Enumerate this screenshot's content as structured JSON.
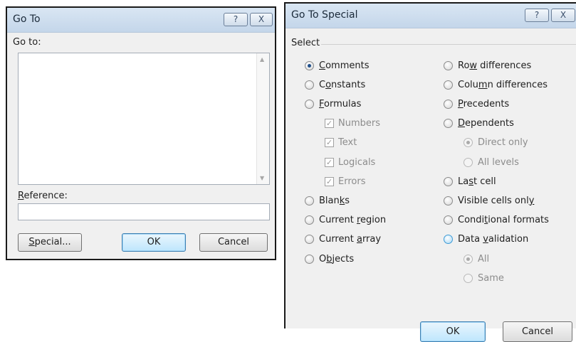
{
  "goto": {
    "title": "Go To",
    "help_btn": "?",
    "close_btn": "X",
    "goto_label": "Go to:",
    "reference_label_prefix": "",
    "reference_label_u": "R",
    "reference_label_rest": "eference:",
    "reference_value": "",
    "special_u": "S",
    "special_rest": "pecial...",
    "ok": "OK",
    "cancel": "Cancel",
    "scroll_up": "▲",
    "scroll_down": "▼"
  },
  "gotospecial": {
    "title": "Go To Special",
    "help_btn": "?",
    "close_btn": "X",
    "group_label": "Select",
    "left": [
      {
        "pre": "",
        "u": "C",
        "post": "omments",
        "kind": "radio",
        "checked": true
      },
      {
        "pre": "C",
        "u": "o",
        "post": "nstants",
        "kind": "radio",
        "checked": false
      },
      {
        "pre": "",
        "u": "F",
        "post": "ormulas",
        "kind": "radio",
        "checked": false
      },
      {
        "pre": "Numbers",
        "u": "",
        "post": "",
        "kind": "check",
        "checked": true,
        "disabled": true
      },
      {
        "pre": "Text",
        "u": "",
        "post": "",
        "kind": "check",
        "checked": true,
        "disabled": true
      },
      {
        "pre": "Logicals",
        "u": "",
        "post": "",
        "kind": "check",
        "checked": true,
        "disabled": true
      },
      {
        "pre": "Errors",
        "u": "",
        "post": "",
        "kind": "check",
        "checked": true,
        "disabled": true
      },
      {
        "pre": "Blan",
        "u": "k",
        "post": "s",
        "kind": "radio",
        "checked": false
      },
      {
        "pre": "Current ",
        "u": "r",
        "post": "egion",
        "kind": "radio",
        "checked": false
      },
      {
        "pre": "Current ",
        "u": "a",
        "post": "rray",
        "kind": "radio",
        "checked": false
      },
      {
        "pre": "O",
        "u": "b",
        "post": "jects",
        "kind": "radio",
        "checked": false
      }
    ],
    "right": [
      {
        "pre": "Ro",
        "u": "w",
        "post": " differences",
        "kind": "radio",
        "checked": false
      },
      {
        "pre": "Colu",
        "u": "m",
        "post": "n differences",
        "kind": "radio",
        "checked": false
      },
      {
        "pre": "",
        "u": "P",
        "post": "recedents",
        "kind": "radio",
        "checked": false
      },
      {
        "pre": "",
        "u": "D",
        "post": "ependents",
        "kind": "radio",
        "checked": false
      },
      {
        "pre": "Direct only",
        "u": "",
        "post": "",
        "kind": "radio",
        "checked": true,
        "disabled": true
      },
      {
        "pre": "All levels",
        "u": "",
        "post": "",
        "kind": "radio",
        "checked": false,
        "disabled": true
      },
      {
        "pre": "La",
        "u": "s",
        "post": "t cell",
        "kind": "radio",
        "checked": false
      },
      {
        "pre": "Visible cells onl",
        "u": "y",
        "post": "",
        "kind": "radio",
        "checked": false
      },
      {
        "pre": "Condi",
        "u": "t",
        "post": "ional formats",
        "kind": "radio",
        "checked": false
      },
      {
        "pre": "Data ",
        "u": "v",
        "post": "alidation",
        "kind": "radio",
        "checked": false,
        "highlight": true
      },
      {
        "pre": "All",
        "u": "",
        "post": "",
        "kind": "radio",
        "checked": true,
        "disabled": true
      },
      {
        "pre": "Same",
        "u": "",
        "post": "",
        "kind": "radio",
        "checked": false,
        "disabled": true
      }
    ],
    "ok": "OK",
    "cancel": "Cancel"
  }
}
